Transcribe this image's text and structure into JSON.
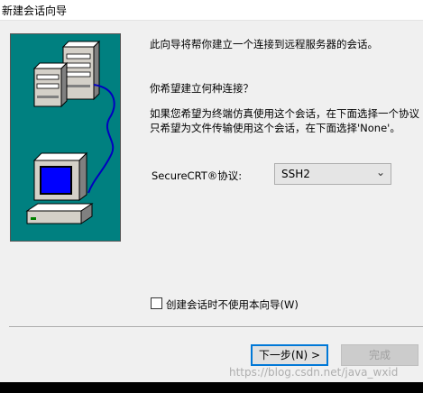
{
  "window": {
    "title": "新建会话向导"
  },
  "intro": "此向导将帮你建立一个连接到远程服务器的会话。",
  "question": "你希望建立何种连接？",
  "desc_line1": "如果您希望为终端仿真使用这个会话，在下面选择一个协议",
  "desc_line2": "只希望为文件传输使用这个会话，在下面选择'None'。",
  "protocol": {
    "label": "SecureCRT®协议:",
    "selected": "SSH2"
  },
  "dont_use_wizard": {
    "label": "创建会话时不使用本向导(W)",
    "checked": false
  },
  "buttons": {
    "next": "下一步(N) >",
    "finish": "完成"
  },
  "watermark": "https://blog.csdn.net/java_wxid",
  "colors": {
    "art_background": "#008080",
    "primary_border": "#0078d7"
  }
}
